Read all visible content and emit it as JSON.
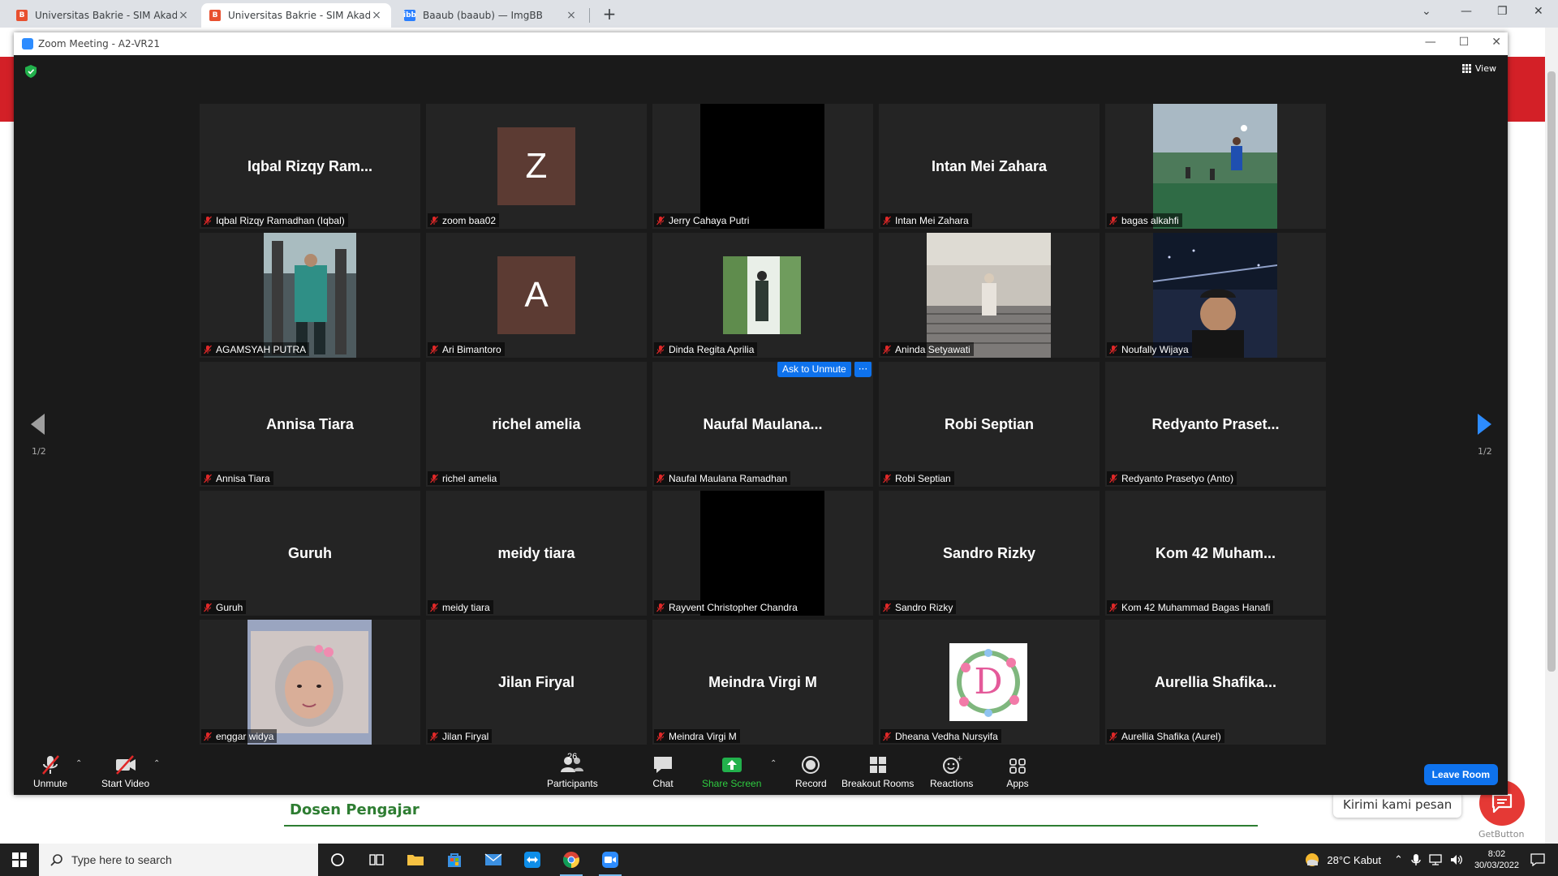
{
  "browser": {
    "tabs": [
      {
        "title": "Universitas Bakrie - SIM Akadem",
        "active": false,
        "favicon": "shield-b-icon"
      },
      {
        "title": "Universitas Bakrie - SIM Akadem",
        "active": true,
        "favicon": "shield-b-icon"
      },
      {
        "title": "Baaub (baaub) — ImgBB",
        "active": false,
        "favicon": "imgbb-icon"
      }
    ],
    "new_tab": "+"
  },
  "page": {
    "heading": "Dosen Pengajar",
    "chat_prompt": "Kirimi kami pesan",
    "chat_widget_brand": "GetButton"
  },
  "zoom": {
    "window_title": "Zoom Meeting - A2-VR21",
    "view_label": "View",
    "page_indicator": "1/2",
    "ask_to_unmute": "Ask to Unmute",
    "more_dots": "···",
    "tiles": [
      {
        "display": "Iqbal Rizqy Ram...",
        "label": "Iqbal Rizqy Ramadhan (Iqbal)",
        "kind": "name"
      },
      {
        "display": "Z",
        "label": "zoom baa02",
        "kind": "avatar",
        "color": "#5c3b33"
      },
      {
        "display": "",
        "label": "Jerry Cahaya Putri",
        "kind": "dark-video"
      },
      {
        "display": "Intan Mei Zahara",
        "label": "Intan Mei Zahara",
        "kind": "name"
      },
      {
        "display": "",
        "label": "bagas alkahfi",
        "kind": "photo-soccer"
      },
      {
        "display": "",
        "label": "AGAMSYAH PUTRA",
        "kind": "photo-street"
      },
      {
        "display": "A",
        "label": "Ari Bimantoro",
        "kind": "avatar",
        "color": "#5c3b33"
      },
      {
        "display": "",
        "label": "Dinda Regita Aprilia",
        "kind": "photo-small-garden"
      },
      {
        "display": "",
        "label": "Aninda Setyawati",
        "kind": "photo-stairs"
      },
      {
        "display": "",
        "label": "Noufally Wijaya",
        "kind": "photo-night"
      },
      {
        "display": "Annisa Tiara",
        "label": "Annisa Tiara",
        "kind": "name"
      },
      {
        "display": "richel amelia",
        "label": "richel amelia",
        "kind": "name"
      },
      {
        "display": "Naufal  Maulana...",
        "label": "Naufal Maulana Ramadhan",
        "kind": "name",
        "ask_unmute": true
      },
      {
        "display": "Robi Septian",
        "label": "Robi Septian",
        "kind": "name"
      },
      {
        "display": "Redyanto  Praset...",
        "label": "Redyanto Prasetyo (Anto)",
        "kind": "name"
      },
      {
        "display": "Guruh",
        "label": "Guruh",
        "kind": "name"
      },
      {
        "display": "meidy tiara",
        "label": "meidy tiara",
        "kind": "name"
      },
      {
        "display": "",
        "label": "Rayvent Christopher Chandra",
        "kind": "dark-video"
      },
      {
        "display": "Sandro Rizky",
        "label": "Sandro Rizky",
        "kind": "name"
      },
      {
        "display": "Kom  42  Muham...",
        "label": "Kom 42 Muhammad Bagas Hanafi",
        "kind": "name"
      },
      {
        "display": "",
        "label": "enggar widya",
        "kind": "photo-selfie"
      },
      {
        "display": "Jilan Firyal",
        "label": "Jilan Firyal",
        "kind": "name"
      },
      {
        "display": "Meindra Virgi M",
        "label": "Meindra Virgi M",
        "kind": "name"
      },
      {
        "display": "D",
        "label": "Dheana Vedha Nursyifa",
        "kind": "photo-small-floral"
      },
      {
        "display": "Aurellia  Shafika...",
        "label": "Aurellia Shafika (Aurel)",
        "kind": "name"
      }
    ],
    "toolbar": {
      "unmute": "Unmute",
      "start_video": "Start Video",
      "participants": "Participants",
      "participants_count": "26",
      "chat": "Chat",
      "share_screen": "Share Screen",
      "record": "Record",
      "breakout_rooms": "Breakout Rooms",
      "reactions": "Reactions",
      "apps": "Apps",
      "leave_room": "Leave Room"
    }
  },
  "taskbar": {
    "search_placeholder": "Type here to search",
    "weather": "28°C  Kabut",
    "time": "8:02",
    "date": "30/03/2022"
  }
}
